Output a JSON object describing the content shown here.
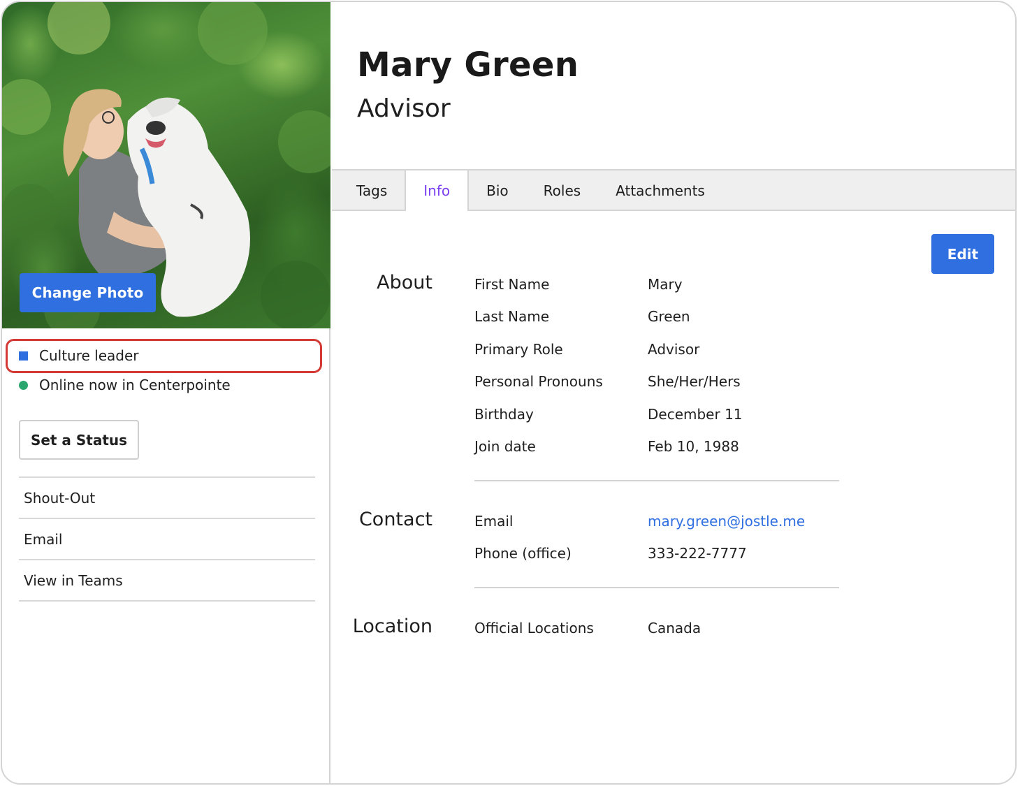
{
  "profile": {
    "name": "Mary Green",
    "title": "Advisor",
    "change_photo_label": "Change Photo",
    "badge": "Culture leader",
    "presence": "Online now in Centerpointe",
    "set_status_label": "Set a Status",
    "actions": [
      "Shout-Out",
      "Email",
      "View in Teams"
    ]
  },
  "tabs": [
    {
      "label": "Tags",
      "active": false
    },
    {
      "label": "Info",
      "active": true
    },
    {
      "label": "Bio",
      "active": false
    },
    {
      "label": "Roles",
      "active": false
    },
    {
      "label": "Attachments",
      "active": false
    }
  ],
  "edit_label": "Edit",
  "about": {
    "heading": "About",
    "fields": [
      {
        "label": "First Name",
        "value": "Mary"
      },
      {
        "label": "Last Name",
        "value": "Green"
      },
      {
        "label": "Primary Role",
        "value": "Advisor"
      },
      {
        "label": "Personal Pronouns",
        "value": "She/Her/Hers"
      },
      {
        "label": "Birthday",
        "value": "December 11"
      },
      {
        "label": "Join date",
        "value": "Feb 10, 1988"
      }
    ]
  },
  "contact": {
    "heading": "Contact",
    "fields": [
      {
        "label": "Email",
        "value": "mary.green@jostle.me"
      },
      {
        "label": "Phone (office)",
        "value": "333-222-7777"
      }
    ]
  },
  "location": {
    "heading": "Location",
    "fields": [
      {
        "label": "Official Locations",
        "value": "Canada"
      }
    ]
  },
  "colors": {
    "accent": "#2f6fe0",
    "active_tab": "#7a3ff0",
    "online": "#2ca66f",
    "highlight": "#d33a35"
  }
}
